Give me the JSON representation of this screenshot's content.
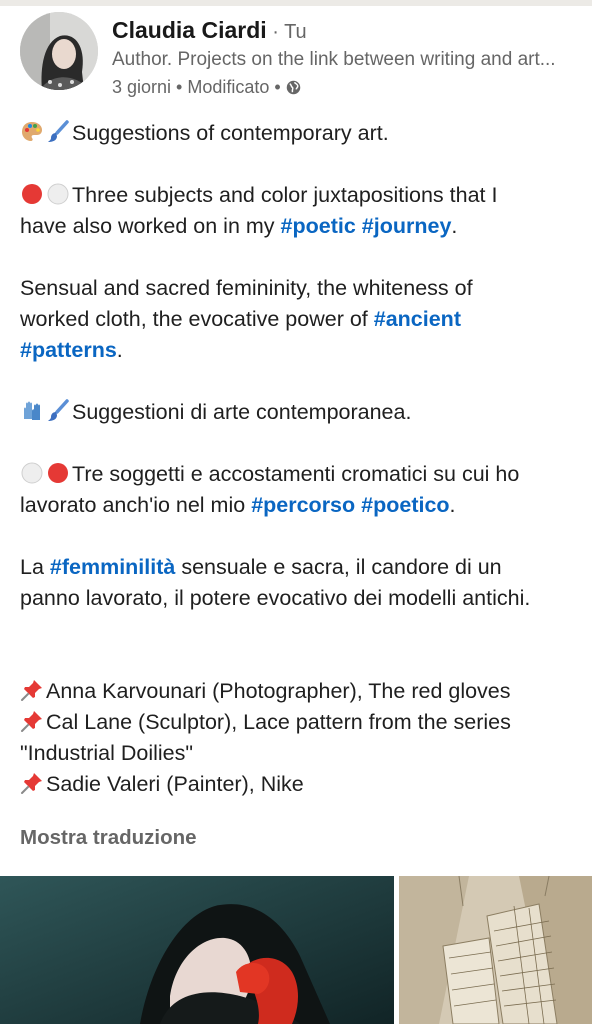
{
  "post": {
    "author": {
      "name": "Claudia Ciardi",
      "degree": " · Tu",
      "headline": "Author. Projects on the link between writing and art...",
      "time": "3 giorni",
      "edited": " • Modificato • ",
      "visibility_icon": "globe-icon"
    },
    "lines": {
      "l1": "Suggestions of contemporary art.",
      "l2a": "Three subjects and color juxtapositions that I",
      "l2b": "have also worked on in my ",
      "tag_poetic": "#poetic",
      "tag_journey": "#journey",
      "l3a": "Sensual and sacred femininity, the whiteness of",
      "l3b": "worked cloth, the evocative power of ",
      "tag_ancient": "#ancient",
      "tag_patterns": "#patterns",
      "l4": "Suggestioni di arte contemporanea.",
      "l5a": "Tre soggetti e accostamenti cromatici su cui ho",
      "l5b": "lavorato anch'io nel mio ",
      "tag_percorso": "#percorso",
      "tag_poetico": "#poetico",
      "l6a_pre": "La ",
      "tag_femminilita": "#femminilità",
      "l6a_post": " sensuale e sacra, il candore di un",
      "l6b": "panno lavorato, il potere evocativo dei modelli antichi.",
      "credit1": "Anna Karvounari (Photographer), The red gloves",
      "credit2a": "Cal Lane (Sculptor), Lace pattern from the series",
      "credit2b": "\"Industrial Doilies\"",
      "credit3": "Sadie Valeri (Painter), Nike",
      "period": ".",
      "space": " "
    },
    "translate_label": "Mostra traduzione",
    "icons": [
      "palette-icon",
      "paintbrush-icon",
      "red-circle-icon",
      "white-circle-icon",
      "gloves-icon",
      "pushpin-icon"
    ]
  },
  "colors": {
    "hashtag": "#0a66c2",
    "secondary_text": "#666666",
    "primary_text": "#1f1f1f"
  }
}
